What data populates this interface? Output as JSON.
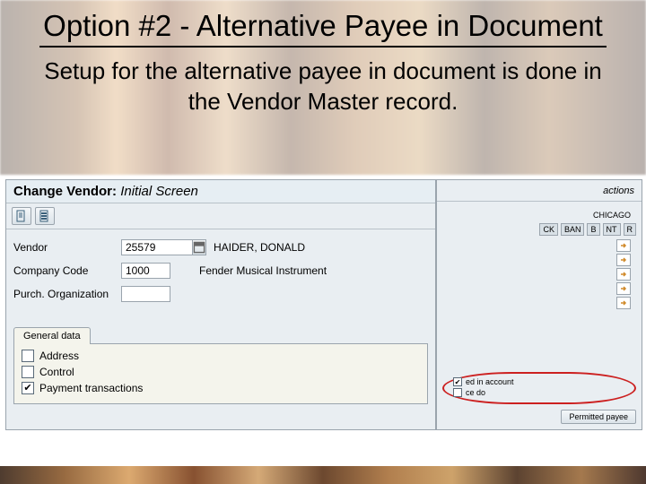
{
  "slide": {
    "title": "Option #2 - Alternative Payee in Document",
    "subtitle": "Setup for the alternative payee in document is done in the Vendor Master record."
  },
  "sap": {
    "screen_title_bold": "Change Vendor:",
    "screen_title_italic": "Initial Screen",
    "fields": {
      "vendor_label": "Vendor",
      "vendor_value": "25579",
      "vendor_desc": "HAIDER, DONALD",
      "company_label": "Company Code",
      "company_value": "1000",
      "company_desc": "Fender Musical Instrument",
      "purch_label": "Purch. Organization",
      "purch_value": ""
    },
    "tab": {
      "label": "General data",
      "address": "Address",
      "control": "Control",
      "payment": "Payment transactions"
    }
  },
  "right": {
    "top_label": "actions",
    "city": "CHICAGO",
    "cols": [
      "CK",
      "BAN",
      "B",
      "NT",
      "R"
    ],
    "oval": {
      "line1": "ed in account",
      "line2": "ce do"
    },
    "perm_btn": "Permitted payee"
  }
}
